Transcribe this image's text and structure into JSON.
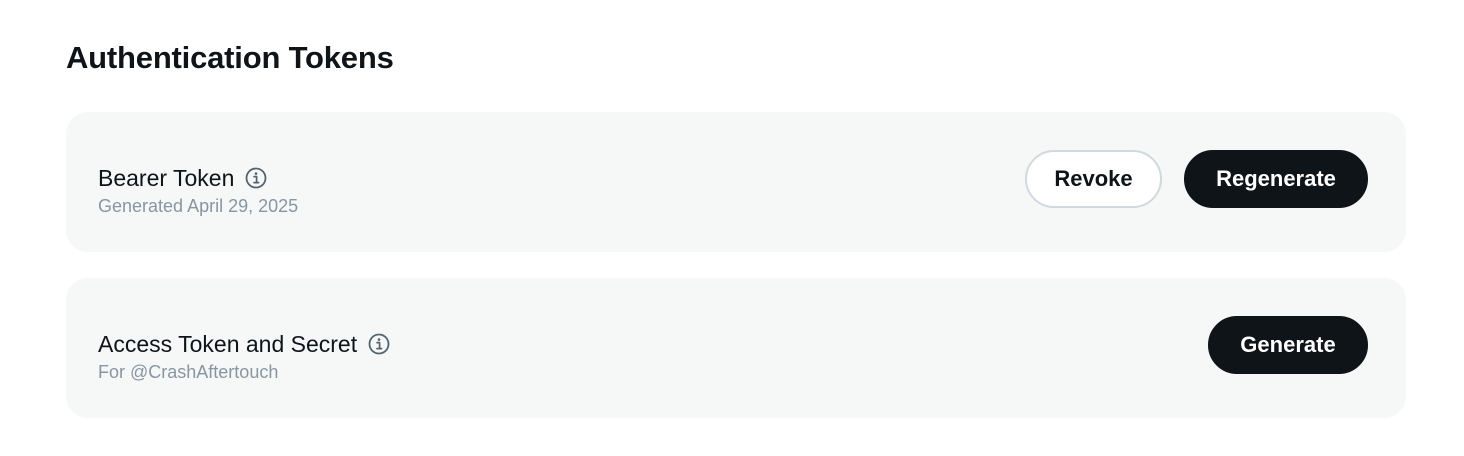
{
  "page": {
    "title": "Authentication Tokens"
  },
  "tokens": [
    {
      "title": "Bearer Token",
      "subtitle": "Generated April 29, 2025",
      "info_icon": "info-circle-icon",
      "actions": {
        "revoke_label": "Revoke",
        "regenerate_label": "Regenerate"
      }
    },
    {
      "title": "Access Token and Secret",
      "subtitle": "For @CrashAftertouch",
      "info_icon": "info-circle-icon",
      "actions": {
        "generate_label": "Generate"
      }
    }
  ],
  "colors": {
    "card_background": "#f6f7f7",
    "primary_button": "#0f1419",
    "subtitle_text": "#8796a3",
    "outline_border": "#cfd9de"
  }
}
